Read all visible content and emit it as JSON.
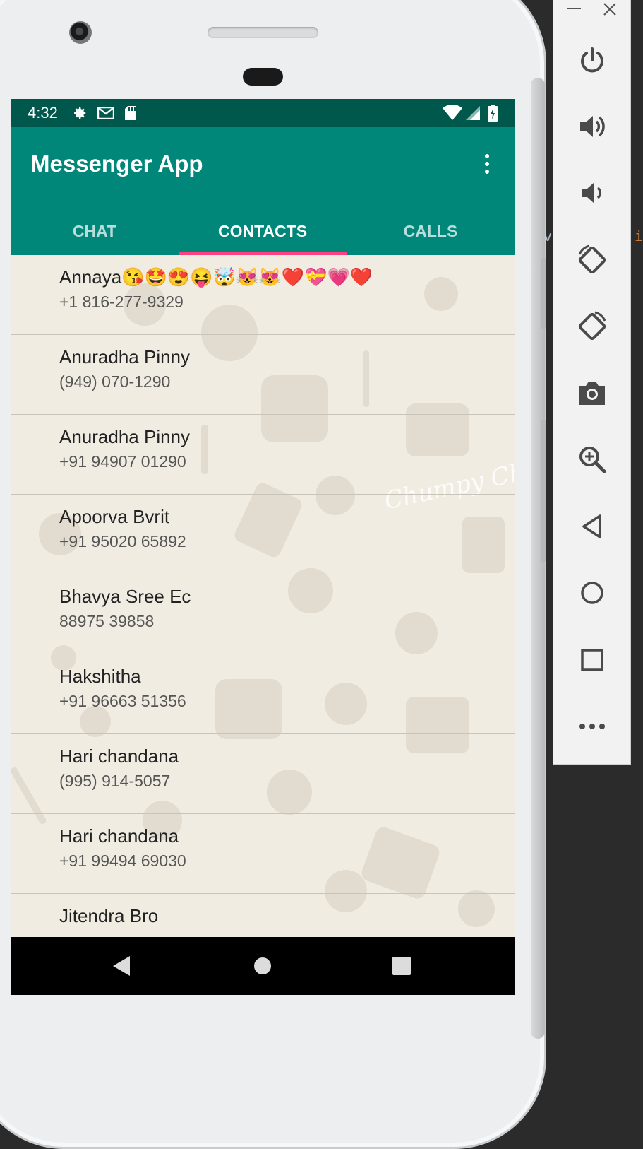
{
  "status_bar": {
    "time": "4:32",
    "left_icons": [
      "gear-icon",
      "gmail-icon",
      "sd-card-icon"
    ],
    "right_icons": [
      "wifi-icon",
      "signal-icon",
      "battery-charging-icon"
    ]
  },
  "app_bar": {
    "title": "Messenger App",
    "menu_icon": "more-vert-icon"
  },
  "tabs": [
    {
      "label": "CHAT",
      "active": false
    },
    {
      "label": "CONTACTS",
      "active": true
    },
    {
      "label": "CALLS",
      "active": false
    }
  ],
  "contacts": [
    {
      "name": "Annaya😘🤩😍😝🤯😻😻❤️💝💗❤️",
      "phone": "+1 816-277-9329"
    },
    {
      "name": "Anuradha Pinny",
      "phone": "(949) 070-1290"
    },
    {
      "name": "Anuradha Pinny",
      "phone": "+91 94907 01290"
    },
    {
      "name": "Apoorva Bvrit",
      "phone": "+91 95020 65892"
    },
    {
      "name": "Bhavya Sree Ec",
      "phone": "88975 39858"
    },
    {
      "name": "Hakshitha",
      "phone": "+91 96663 51356"
    },
    {
      "name": "Hari chandana",
      "phone": "(995) 914-5057"
    },
    {
      "name": "Hari chandana",
      "phone": "+91 99494 69030"
    },
    {
      "name": "Jitendra Bro",
      "phone": ""
    }
  ],
  "nav_bar": [
    "back-triangle-icon",
    "home-circle-icon",
    "recents-square-icon"
  ],
  "wallpaper_text": "Chumpy Chikito",
  "emulator_panel": {
    "window_buttons": [
      "minimize-icon",
      "close-icon"
    ],
    "controls": [
      "power-icon",
      "volume-up-icon",
      "volume-down-icon",
      "rotate-left-icon",
      "rotate-right-icon",
      "screenshot-icon",
      "zoom-icon",
      "back-icon",
      "home-icon",
      "overview-icon",
      "more-icon"
    ]
  },
  "ide_glyphs": [
    "v",
    "i"
  ],
  "colors": {
    "status_bar": "#00574b",
    "app_bar": "#00877a",
    "tab_indicator": "#ff4081",
    "list_background": "#f1ece2"
  }
}
